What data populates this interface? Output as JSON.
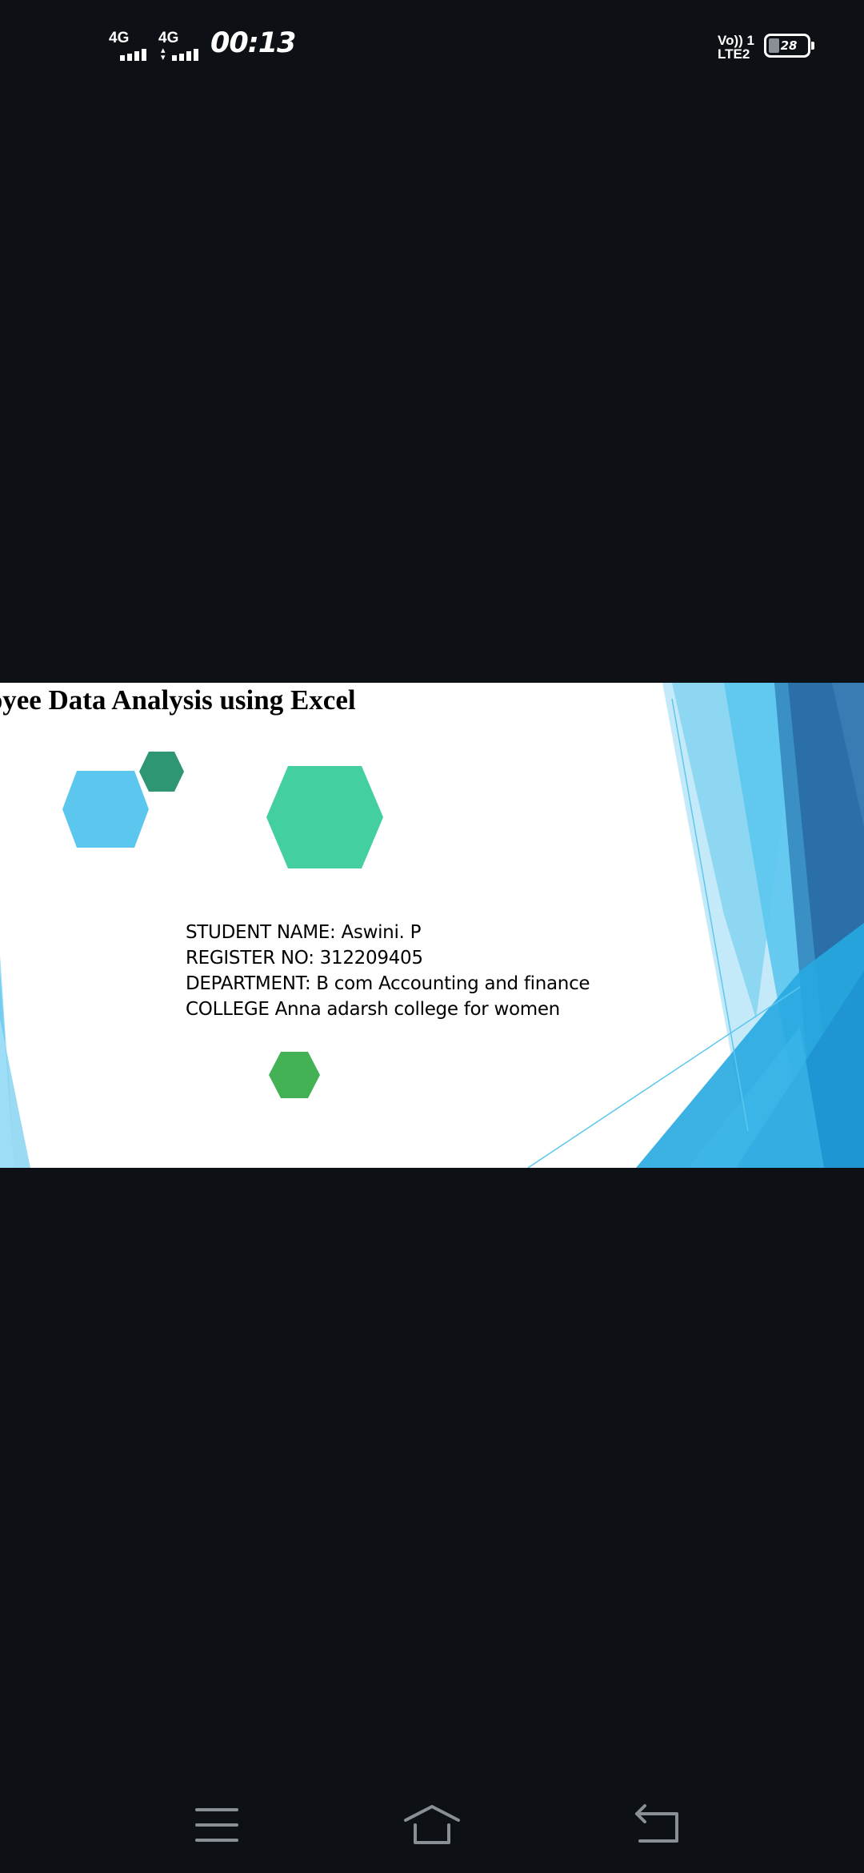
{
  "status_bar": {
    "sim1_network": "4G",
    "sim2_network": "4G",
    "time": "00:13",
    "volte_line1": "Vo)) 1",
    "volte_line2": "LTE2",
    "battery_level": 28,
    "battery_text": "28"
  },
  "slide": {
    "title": "Employee Data Analysis using Excel",
    "student_name": "STUDENT NAME: Aswini. P",
    "register_no": "REGISTER NO: 312209405",
    "department": "DEPARTMENT: B com Accounting and finance",
    "college": "COLLEGE Anna adarsh college for women",
    "colors": {
      "hex_light_blue": "#5cc7ee",
      "hex_dark_green": "#2e9672",
      "hex_teal": "#44cfa1",
      "hex_green": "#43b254",
      "accent_blue": "#1fa3dd",
      "accent_dark_blue": "#2a6fa8"
    }
  },
  "nav_bar": {
    "menu_icon": "menu-icon",
    "home_icon": "home-icon",
    "back_icon": "back-icon"
  }
}
